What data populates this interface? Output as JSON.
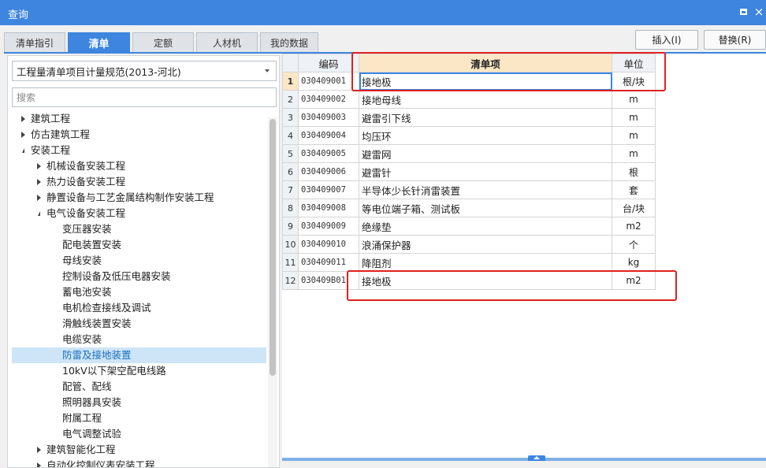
{
  "window": {
    "title": "查询",
    "close_glyph": "×"
  },
  "tabs": [
    {
      "label": "清单指引",
      "active": false
    },
    {
      "label": "清单",
      "active": true
    },
    {
      "label": "定额",
      "active": false
    },
    {
      "label": "人材机",
      "active": false
    },
    {
      "label": "我的数据",
      "active": false
    }
  ],
  "actions": {
    "insert_label": "插入(I)",
    "replace_label": "替换(R)"
  },
  "left_panel": {
    "spec_selected": "工程量清单项目计量规范(2013-河北)",
    "search_placeholder": "搜索",
    "tree": [
      {
        "label": "建筑工程",
        "level": 0,
        "arrow": "right"
      },
      {
        "label": "仿古建筑工程",
        "level": 0,
        "arrow": "right"
      },
      {
        "label": "安装工程",
        "level": 0,
        "arrow": "down"
      },
      {
        "label": "机械设备安装工程",
        "level": 1,
        "arrow": "right"
      },
      {
        "label": "热力设备安装工程",
        "level": 1,
        "arrow": "right"
      },
      {
        "label": "静置设备与工艺金属结构制作安装工程",
        "level": 1,
        "arrow": "right"
      },
      {
        "label": "电气设备安装工程",
        "level": 1,
        "arrow": "down"
      },
      {
        "label": "变压器安装",
        "level": 2,
        "arrow": ""
      },
      {
        "label": "配电装置安装",
        "level": 2,
        "arrow": ""
      },
      {
        "label": "母线安装",
        "level": 2,
        "arrow": ""
      },
      {
        "label": "控制设备及低压电器安装",
        "level": 2,
        "arrow": ""
      },
      {
        "label": "蓄电池安装",
        "level": 2,
        "arrow": ""
      },
      {
        "label": "电机检查接线及调试",
        "level": 2,
        "arrow": ""
      },
      {
        "label": "滑触线装置安装",
        "level": 2,
        "arrow": ""
      },
      {
        "label": "电缆安装",
        "level": 2,
        "arrow": ""
      },
      {
        "label": "防雷及接地装置",
        "level": 2,
        "arrow": "",
        "selected": true
      },
      {
        "label": "10kV以下架空配电线路",
        "level": 2,
        "arrow": ""
      },
      {
        "label": "配管、配线",
        "level": 2,
        "arrow": ""
      },
      {
        "label": "照明器具安装",
        "level": 2,
        "arrow": ""
      },
      {
        "label": "附属工程",
        "level": 2,
        "arrow": ""
      },
      {
        "label": "电气调整试验",
        "level": 2,
        "arrow": ""
      },
      {
        "label": "建筑智能化工程",
        "level": 1,
        "arrow": "right"
      },
      {
        "label": "自动化控制仪表安装工程",
        "level": 1,
        "arrow": "right"
      }
    ]
  },
  "grid": {
    "headers": {
      "code": "编码",
      "name": "清单项",
      "unit": "单位"
    },
    "rows": [
      {
        "num": "1",
        "code": "030409001",
        "name": "接地极",
        "unit": "根/块"
      },
      {
        "num": "2",
        "code": "030409002",
        "name": "接地母线",
        "unit": "m"
      },
      {
        "num": "3",
        "code": "030409003",
        "name": "避雷引下线",
        "unit": "m"
      },
      {
        "num": "4",
        "code": "030409004",
        "name": "均压环",
        "unit": "m"
      },
      {
        "num": "5",
        "code": "030409005",
        "name": "避雷网",
        "unit": "m"
      },
      {
        "num": "6",
        "code": "030409006",
        "name": "避雷针",
        "unit": "根"
      },
      {
        "num": "7",
        "code": "030409007",
        "name": "半导体少长针消雷装置",
        "unit": "套"
      },
      {
        "num": "8",
        "code": "030409008",
        "name": "等电位端子箱、测试板",
        "unit": "台/块"
      },
      {
        "num": "9",
        "code": "030409009",
        "name": "绝缘垫",
        "unit": "m2"
      },
      {
        "num": "10",
        "code": "030409010",
        "name": "浪涌保护器",
        "unit": "个"
      },
      {
        "num": "11",
        "code": "030409011",
        "name": "降阻剂",
        "unit": "kg"
      },
      {
        "num": "12",
        "code": "030409B01",
        "name": "接地极",
        "unit": "m2"
      }
    ]
  },
  "colors": {
    "accent": "#3d85de",
    "highlight_header": "#fbe7c5",
    "annotation": "#e02020",
    "selected_tree": "#cde5f7"
  }
}
